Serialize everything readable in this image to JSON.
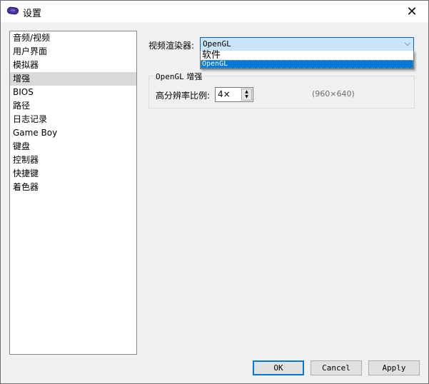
{
  "window": {
    "title": "设置",
    "icon": "gba-controller-icon",
    "close_glyph": "✕"
  },
  "sidebar": {
    "items": [
      {
        "label": "音频/视频",
        "selected": false
      },
      {
        "label": "用户界面",
        "selected": false
      },
      {
        "label": "模拟器",
        "selected": false
      },
      {
        "label": "增强",
        "selected": true
      },
      {
        "label": "BIOS",
        "selected": false
      },
      {
        "label": "路径",
        "selected": false
      },
      {
        "label": "日志记录",
        "selected": false
      },
      {
        "label": "Game Boy",
        "selected": false
      },
      {
        "label": "键盘",
        "selected": false
      },
      {
        "label": "控制器",
        "selected": false
      },
      {
        "label": "快捷键",
        "selected": false
      },
      {
        "label": "着色器",
        "selected": false
      }
    ]
  },
  "renderer": {
    "label": "视频渲染器:",
    "value": "OpenGL",
    "arrow_glyph": "⌵",
    "options": [
      "软件",
      "OpenGL"
    ],
    "highlighted_option": "OpenGL"
  },
  "opengl_group": {
    "title_prefix": "OpenGL",
    "title_suffix": " 增强",
    "scale_label": "高分辨率比例:",
    "scale_value": "4×",
    "resolution_text": "(960×640)",
    "spin_up_glyph": "▲",
    "spin_down_glyph": "▼"
  },
  "buttons": {
    "ok": "OK",
    "cancel": "Cancel",
    "apply": "Apply"
  }
}
